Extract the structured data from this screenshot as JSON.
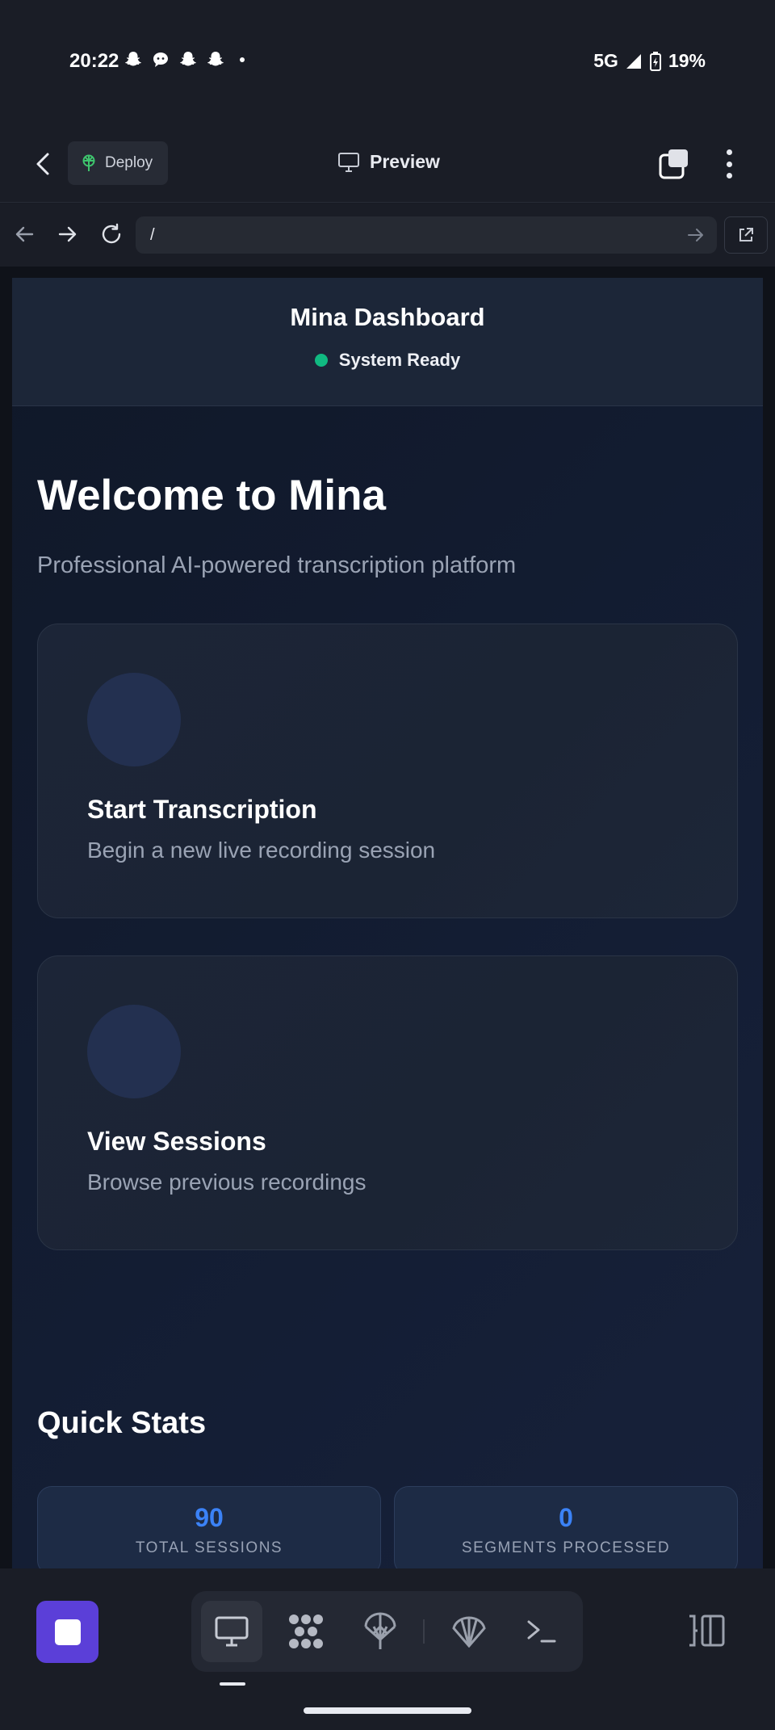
{
  "status_bar": {
    "time": "20:22",
    "notification_icons": [
      "snapchat-icon",
      "chat-bubble-icon",
      "snapchat-icon",
      "snapchat-icon"
    ],
    "network": "5G",
    "battery": "19%"
  },
  "app_header": {
    "deploy_label": "Deploy",
    "title": "Preview"
  },
  "url_bar": {
    "url": "/"
  },
  "page": {
    "header_title": "Mina Dashboard",
    "status_text": "System Ready",
    "welcome_heading": "Welcome to Mina",
    "tagline": "Professional AI-powered transcription platform",
    "cards": [
      {
        "title": "Start Transcription",
        "description": "Begin a new live recording session"
      },
      {
        "title": "View Sessions",
        "description": "Browse previous recordings"
      }
    ],
    "quick_stats_title": "Quick Stats",
    "stats": [
      {
        "value": "90",
        "label": "TOTAL SESSIONS"
      },
      {
        "value": "0",
        "label": "SEGMENTS PROCESSED"
      }
    ]
  },
  "bottom_toolbar": {
    "tools": [
      "monitor-icon",
      "workflow-icon",
      "deploy-icon",
      "shell-icon",
      "terminal-icon"
    ],
    "active_tool": "monitor-icon"
  },
  "colors": {
    "accent": "#5b3fd8",
    "status_ok": "#10b981",
    "stat_number": "#3b82f6",
    "deploy_icon": "#3ec46d"
  }
}
